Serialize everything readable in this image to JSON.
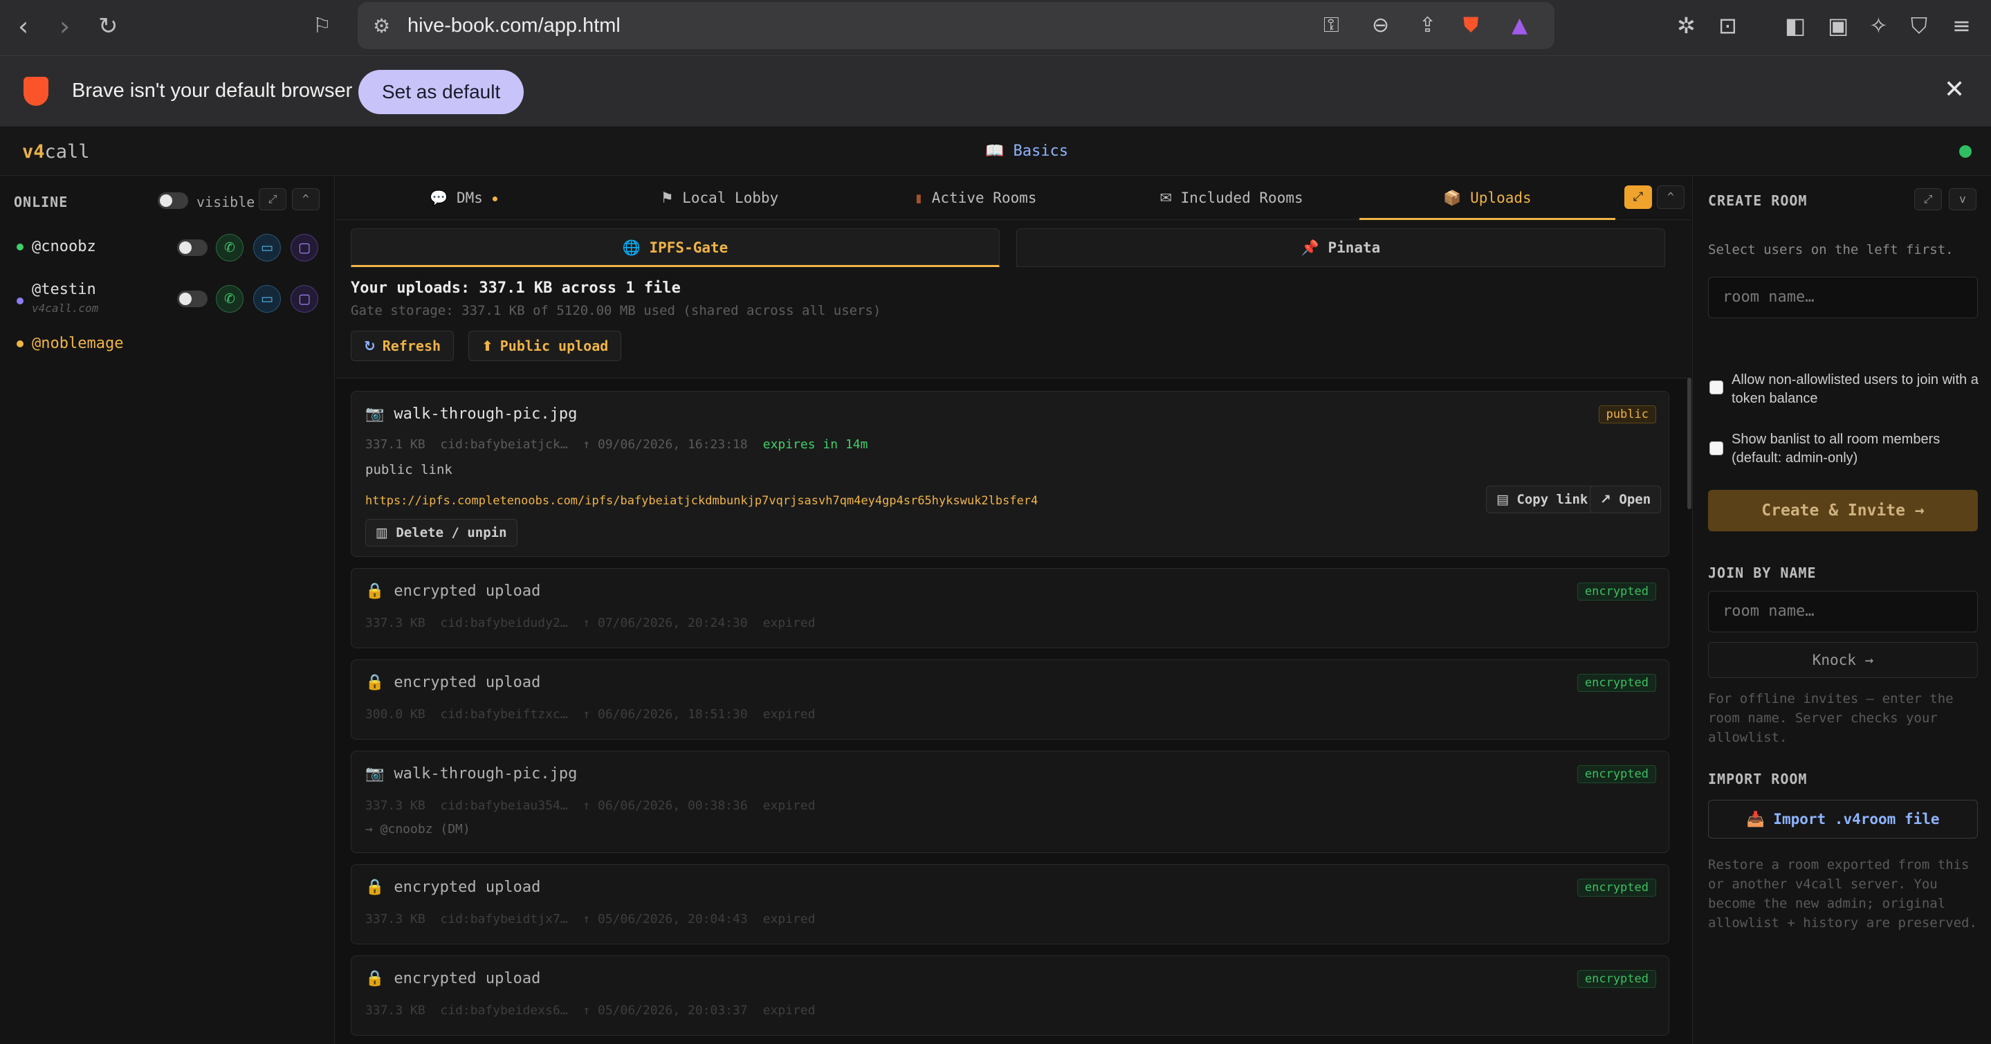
{
  "browser": {
    "url": "hive-book.com/app.html",
    "infobar_message": "Brave isn't your default browser",
    "set_default_label": "Set as default"
  },
  "app": {
    "brand_prefix": "v4",
    "brand_suffix": "call",
    "center_title": "Basics",
    "center_title_icon": "📖"
  },
  "left": {
    "header": "ONLINE",
    "visible_label": "visible",
    "expand_icon": "⤢",
    "collapse_icon": "^",
    "users": [
      {
        "handle": "@cnoobz",
        "color": "#3fcf6a"
      },
      {
        "handle": "@testin",
        "sub": "v4call.com",
        "color": "#8c7cf5"
      },
      {
        "handle": "@noblemage",
        "color": "#f0b448"
      }
    ],
    "call_icon": "✆",
    "video_icon": "▭",
    "chat_icon": "▢"
  },
  "tabs": [
    {
      "icon": "💬",
      "label": "DMs"
    },
    {
      "icon": "⚑",
      "label": "Local Lobby"
    },
    {
      "icon": "▮",
      "label": "Active Rooms"
    },
    {
      "icon": "✉",
      "label": "Included Rooms"
    },
    {
      "icon": "📦",
      "label": "Uploads"
    }
  ],
  "subtabs": [
    {
      "icon": "🌐",
      "label": "IPFS-Gate"
    },
    {
      "icon": "📌",
      "label": "Pinata"
    }
  ],
  "uploads": {
    "summary": "Your uploads: 337.1 KB across 1 file",
    "gate": "Gate storage: 337.1 KB of 5120.00 MB used (shared across all users)",
    "refresh_label": "Refresh",
    "public_upload_label": "Public upload",
    "public_link_label": "public link",
    "copy_link_label": "Copy link",
    "open_label": "Open",
    "delete_label": "Delete / unpin",
    "items": [
      {
        "icon": "📷",
        "name": "walk-through-pic.jpg",
        "badge": "public",
        "size": "337.1 KB",
        "cid": "cid:bafybeiatjck…",
        "date": "↑ 09/06/2026, 16:23:18",
        "status": "expires in 14m",
        "link": "https://ipfs.completenoobs.com/ipfs/bafybeiatjckdmbunkjp7vqrjsasvh7qm4ey4gp4sr65hykswuk2lbsfer4"
      },
      {
        "icon": "🔒",
        "name": "encrypted upload",
        "badge": "encrypted",
        "size": "337.3 KB",
        "cid": "cid:bafybeidudy2…",
        "date": "↑ 07/06/2026, 20:24:30",
        "status": "expired"
      },
      {
        "icon": "🔒",
        "name": "encrypted upload",
        "badge": "encrypted",
        "size": "300.0 KB",
        "cid": "cid:bafybeiftzxc…",
        "date": "↑ 06/06/2026, 18:51:30",
        "status": "expired"
      },
      {
        "icon": "📷",
        "name": "walk-through-pic.jpg",
        "badge": "encrypted",
        "size": "337.3 KB",
        "cid": "cid:bafybeiau354…",
        "date": "↑ 06/06/2026, 00:38:36",
        "status": "expired",
        "dm": "→ @cnoobz (DM)"
      },
      {
        "icon": "🔒",
        "name": "encrypted upload",
        "badge": "encrypted",
        "size": "337.3 KB",
        "cid": "cid:bafybeidtjx7…",
        "date": "↑ 05/06/2026, 20:04:43",
        "status": "expired"
      },
      {
        "icon": "🔒",
        "name": "encrypted upload",
        "badge": "encrypted",
        "size": "337.3 KB",
        "cid": "cid:bafybeidexs6…",
        "date": "↑ 05/06/2026, 20:03:37",
        "status": "expired"
      }
    ]
  },
  "right": {
    "create_header": "CREATE ROOM",
    "create_hint": "Select users on the left first.",
    "room_placeholder": "room name…",
    "allow_label": "Allow non-allowlisted users to join with a token balance",
    "banlist_label": "Show banlist to all room members (default: admin-only)",
    "create_button": "Create & Invite →",
    "join_header": "JOIN BY NAME",
    "join_placeholder": "room name…",
    "knock_button": "Knock →",
    "join_help": "For offline invites — enter the room name. Server checks your allowlist.",
    "import_header": "IMPORT ROOM",
    "import_button": "Import .v4room file",
    "import_icon": "📥",
    "import_help": "Restore a room exported from this or another v4call server. You become the new admin; original allowlist + history are preserved."
  }
}
